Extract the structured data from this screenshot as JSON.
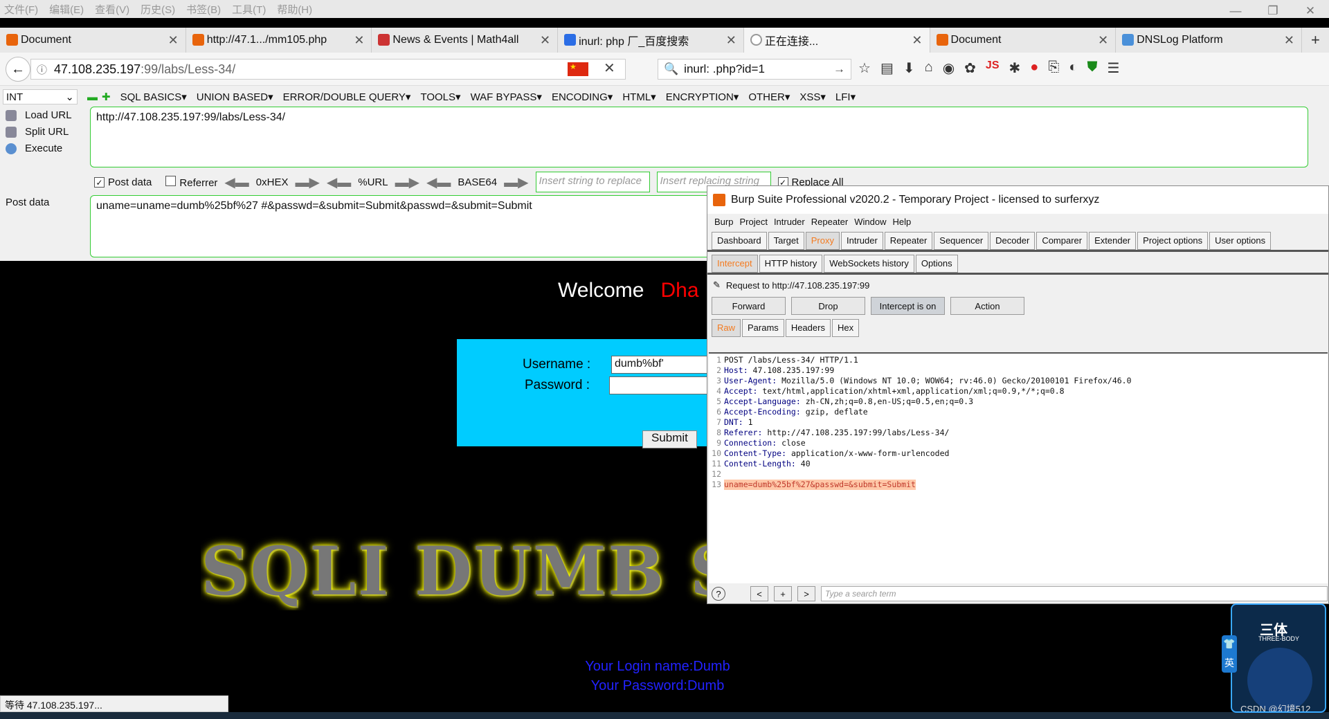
{
  "menubar": [
    "文件(F)",
    "编辑(E)",
    "查看(V)",
    "历史(S)",
    "书签(B)",
    "工具(T)",
    "帮助(H)"
  ],
  "window_controls": [
    "—",
    "❐",
    "✕"
  ],
  "tabs": [
    {
      "title": "Document",
      "icon": "burp-logo-icon"
    },
    {
      "title": "http://47.1.../mm105.php",
      "icon": "burp-logo-icon"
    },
    {
      "title": "News & Events | Math4all",
      "icon": "math-icon"
    },
    {
      "title": "inurl: php 厂_百度搜索",
      "icon": "baidu-paw-icon"
    },
    {
      "title": "正在连接...",
      "icon": "loading-icon"
    },
    {
      "title": "Document",
      "icon": "burp-logo-icon"
    },
    {
      "title": "DNSLog Platform",
      "icon": "dns-icon"
    }
  ],
  "navbar": {
    "url_host": "47.108.235.197",
    "url_path": ":99/labs/Less-34/",
    "search": "inurl: .php?id=1"
  },
  "hackbar": {
    "select": "INT",
    "menus": [
      "SQL BASICS▾",
      "UNION BASED▾",
      "ERROR/DOUBLE QUERY▾",
      "TOOLS▾",
      "WAF BYPASS▾",
      "ENCODING▾",
      "HTML▾",
      "ENCRYPTION▾",
      "OTHER▾",
      "XSS▾",
      "LFI▾"
    ],
    "load_url": "Load URL",
    "split_url": "Split URL",
    "execute": "Execute",
    "url": "http://47.108.235.197:99/labs/Less-34/",
    "post_data_cb": "Post data",
    "referrer_cb": "Referrer",
    "hex": "0xHEX",
    "urlenc": "%URL",
    "base64": "BASE64",
    "replace_ph": "Insert string to replace",
    "replacing_ph": "Insert replacing string",
    "replace_all": "Replace All",
    "post_label": "Post data",
    "post": "uname=uname=dumb%25bf%27  #&passwd=&submit=Submit&passwd=&submit=Submit"
  },
  "page": {
    "welcome": "Welcome",
    "welcome_name": "Dha",
    "username_label": "Username :",
    "username_value": "dumb%bf'",
    "password_label": "Password :",
    "submit": "Submit",
    "banner": "SQLI DUMB S",
    "login_name": "Your Login name:Dumb",
    "login_pass": "Your Password:Dumb"
  },
  "status": "等待 47.108.235.197...",
  "burp": {
    "title": "Burp Suite Professional v2020.2 - Temporary Project - licensed to surferxyz",
    "menu": [
      "Burp",
      "Project",
      "Intruder",
      "Repeater",
      "Window",
      "Help"
    ],
    "main_tabs": [
      "Dashboard",
      "Target",
      "Proxy",
      "Intruder",
      "Repeater",
      "Sequencer",
      "Decoder",
      "Comparer",
      "Extender",
      "Project options",
      "User options"
    ],
    "sub_tabs": [
      "Intercept",
      "HTTP history",
      "WebSockets history",
      "Options"
    ],
    "request_to": "Request to http://47.108.235.197:99",
    "buttons": [
      "Forward",
      "Drop",
      "Intercept is on",
      "Action"
    ],
    "view_tabs": [
      "Raw",
      "Params",
      "Headers",
      "Hex"
    ],
    "lines": [
      {
        "k": "",
        "v": "POST /labs/Less-34/ HTTP/1.1"
      },
      {
        "k": "Host:",
        "v": " 47.108.235.197:99"
      },
      {
        "k": "User-Agent:",
        "v": " Mozilla/5.0 (Windows NT 10.0; WOW64; rv:46.0) Gecko/20100101 Firefox/46.0"
      },
      {
        "k": "Accept:",
        "v": " text/html,application/xhtml+xml,application/xml;q=0.9,*/*;q=0.8"
      },
      {
        "k": "Accept-Language:",
        "v": " zh-CN,zh;q=0.8,en-US;q=0.5,en;q=0.3"
      },
      {
        "k": "Accept-Encoding:",
        "v": " gzip, deflate"
      },
      {
        "k": "DNT:",
        "v": " 1"
      },
      {
        "k": "Referer:",
        "v": " http://47.108.235.197:99/labs/Less-34/"
      },
      {
        "k": "Connection:",
        "v": " close"
      },
      {
        "k": "Content-Type:",
        "v": " application/x-www-form-urlencoded"
      },
      {
        "k": "Content-Length:",
        "v": " 40"
      },
      {
        "k": "",
        "v": ""
      },
      {
        "k": "",
        "v": "uname=dumb%25bf%27&passwd=&submit=Submit",
        "hl": true
      }
    ],
    "search_ph": "Type a search term"
  },
  "widget": {
    "title": "三体",
    "subtitle": "THREE-BODY",
    "csdn": "CSDN @幻境512",
    "ime": "英"
  }
}
